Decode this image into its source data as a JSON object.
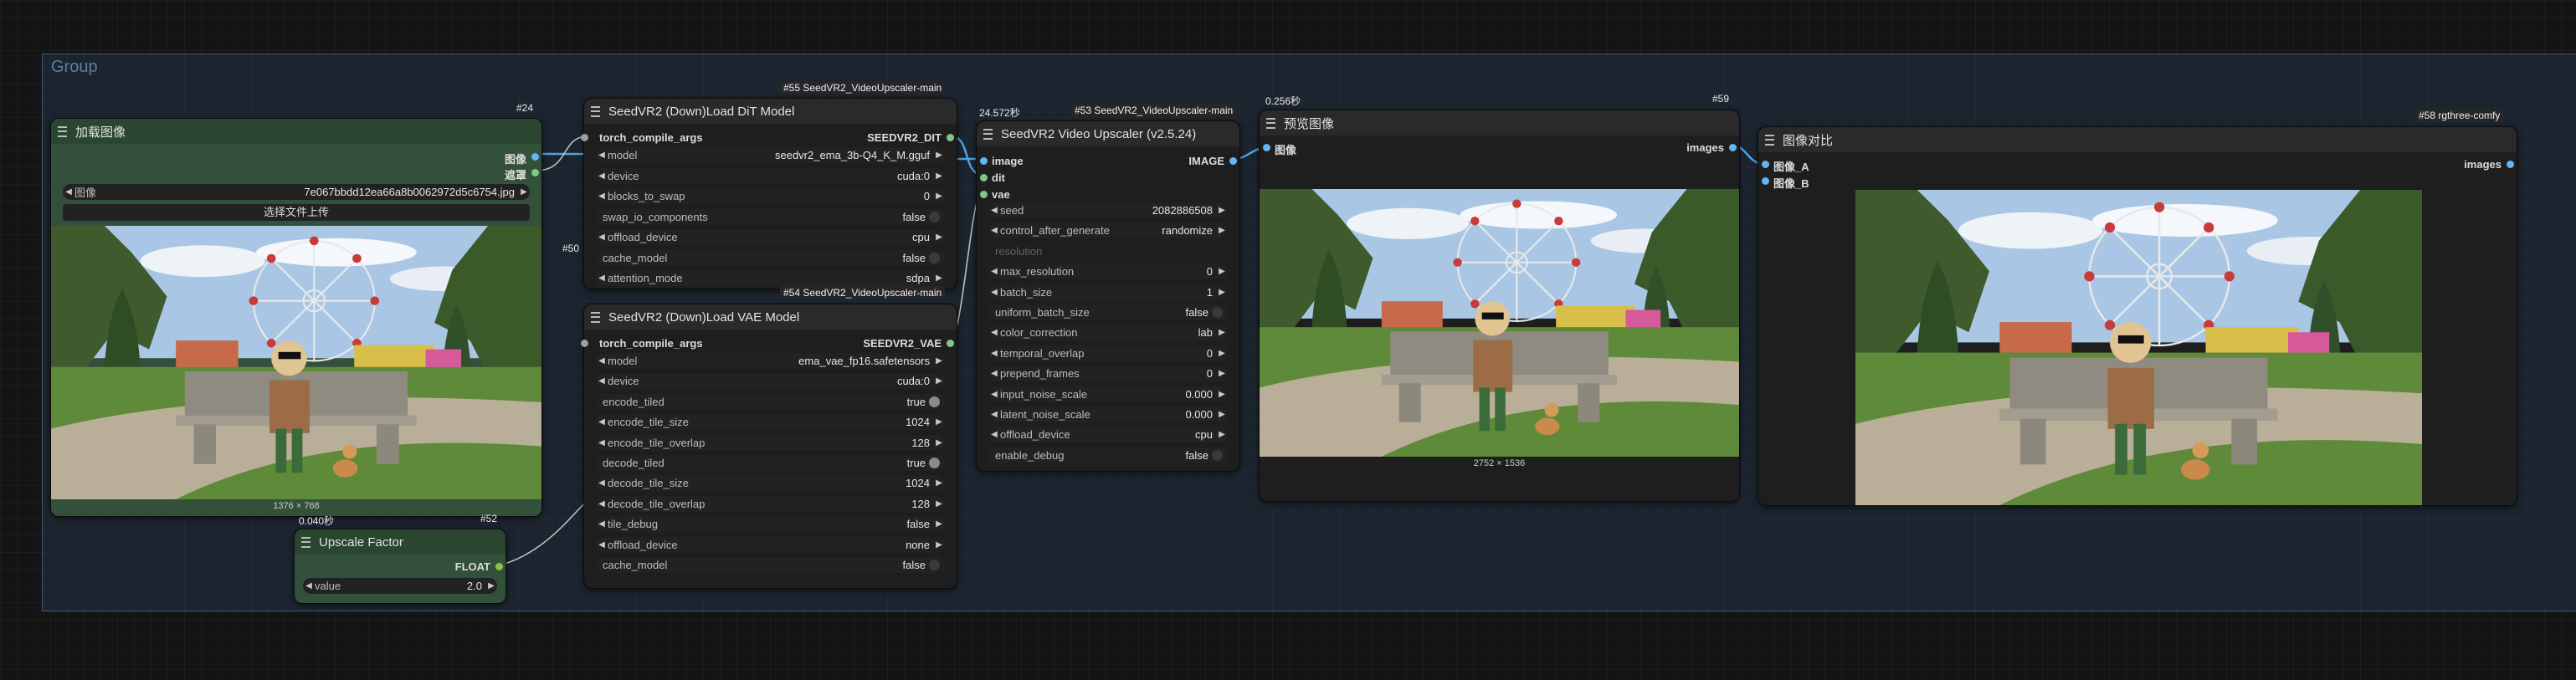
{
  "group": {
    "title": "Group"
  },
  "wires_color": "#4ea3e6",
  "load_image": {
    "title": "加载图像",
    "id": "#24",
    "outputs": [
      "图像",
      "遮罩"
    ],
    "image_file": "7e067bbdd12ea66a8b0062972d5c6754.jpg",
    "image_label": "图像",
    "upload_button": "选择文件上传",
    "dims": "1376 × 768",
    "time": "0.040秒"
  },
  "upscale_factor": {
    "title": "Upscale Factor",
    "id": "#52",
    "output": "FLOAT",
    "widget": {
      "name": "value",
      "value": "2.0"
    }
  },
  "dit_loader": {
    "title": "SeedVR2 (Down)Load DiT Model",
    "tag": "#55 SeedVR2_VideoUpscaler-main",
    "side_id": "#50",
    "input": "torch_compile_args",
    "output": "SEEDVR2_DIT",
    "widgets": [
      {
        "name": "model",
        "value": "seedvr2_ema_3b-Q4_K_M.gguf",
        "kind": "combo"
      },
      {
        "name": "device",
        "value": "cuda:0",
        "kind": "combo"
      },
      {
        "name": "blocks_to_swap",
        "value": "0",
        "kind": "number"
      },
      {
        "name": "swap_io_components",
        "value": "false",
        "kind": "toggle"
      },
      {
        "name": "offload_device",
        "value": "cpu",
        "kind": "combo"
      },
      {
        "name": "cache_model",
        "value": "false",
        "kind": "toggle"
      },
      {
        "name": "attention_mode",
        "value": "sdpa",
        "kind": "combo"
      }
    ]
  },
  "vae_loader": {
    "title": "SeedVR2 (Down)Load VAE Model",
    "tag": "#54 SeedVR2_VideoUpscaler-main",
    "input": "torch_compile_args",
    "output": "SEEDVR2_VAE",
    "widgets": [
      {
        "name": "model",
        "value": "ema_vae_fp16.safetensors",
        "kind": "combo"
      },
      {
        "name": "device",
        "value": "cuda:0",
        "kind": "combo"
      },
      {
        "name": "encode_tiled",
        "value": "true",
        "kind": "toggle"
      },
      {
        "name": "encode_tile_size",
        "value": "1024",
        "kind": "number"
      },
      {
        "name": "encode_tile_overlap",
        "value": "128",
        "kind": "number"
      },
      {
        "name": "decode_tiled",
        "value": "true",
        "kind": "toggle"
      },
      {
        "name": "decode_tile_size",
        "value": "1024",
        "kind": "number"
      },
      {
        "name": "decode_tile_overlap",
        "value": "128",
        "kind": "number"
      },
      {
        "name": "tile_debug",
        "value": "false",
        "kind": "combo"
      },
      {
        "name": "offload_device",
        "value": "none",
        "kind": "combo"
      },
      {
        "name": "cache_model",
        "value": "false",
        "kind": "toggle"
      }
    ]
  },
  "upscaler": {
    "title": "SeedVR2 Video Upscaler (v2.5.24)",
    "tag": "#53 SeedVR2_VideoUpscaler-main",
    "time": "24.572秒",
    "inputs": [
      "image",
      "dit",
      "vae"
    ],
    "output": "IMAGE",
    "widgets": [
      {
        "name": "seed",
        "value": "2082886508",
        "kind": "number"
      },
      {
        "name": "control_after_generate",
        "value": "randomize",
        "kind": "combo"
      },
      {
        "name": "resolution",
        "value": "",
        "kind": "disabled"
      },
      {
        "name": "max_resolution",
        "value": "0",
        "kind": "number"
      },
      {
        "name": "batch_size",
        "value": "1",
        "kind": "number"
      },
      {
        "name": "uniform_batch_size",
        "value": "false",
        "kind": "toggle"
      },
      {
        "name": "color_correction",
        "value": "lab",
        "kind": "combo"
      },
      {
        "name": "temporal_overlap",
        "value": "0",
        "kind": "number"
      },
      {
        "name": "prepend_frames",
        "value": "0",
        "kind": "number"
      },
      {
        "name": "input_noise_scale",
        "value": "0.000",
        "kind": "number"
      },
      {
        "name": "latent_noise_scale",
        "value": "0.000",
        "kind": "number"
      },
      {
        "name": "offload_device",
        "value": "cpu",
        "kind": "combo"
      },
      {
        "name": "enable_debug",
        "value": "false",
        "kind": "toggle"
      }
    ]
  },
  "preview": {
    "title": "预览图像",
    "id": "#59",
    "time": "0.256秒",
    "input": "图像",
    "output": "images",
    "dims": "2752 × 1536"
  },
  "compare": {
    "title": "图像对比",
    "tag": "#58 rgthree-comfy",
    "inputs": [
      "图像_A",
      "图像_B"
    ],
    "output": "images"
  }
}
